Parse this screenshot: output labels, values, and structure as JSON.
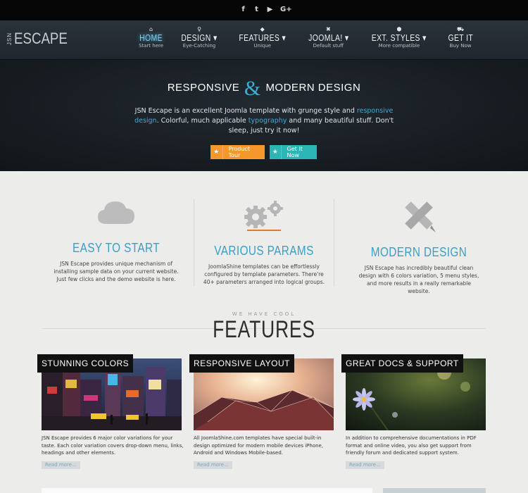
{
  "social": {
    "icons": [
      {
        "name": "facebook-icon",
        "glyph": "f"
      },
      {
        "name": "twitter-icon",
        "glyph": "t"
      },
      {
        "name": "youtube-icon",
        "glyph": "▶"
      },
      {
        "name": "google-plus-icon",
        "glyph": "G+"
      }
    ]
  },
  "logo": {
    "prefix": "JSN",
    "main": "ESCAPE"
  },
  "nav": {
    "items": [
      {
        "icon": "⌂",
        "label": "HOME",
        "sub": "Start here"
      },
      {
        "icon": "♀",
        "label": "DESIGN ▾",
        "sub": "Eye-Catching"
      },
      {
        "icon": "◆",
        "label": "FEATURES ▾",
        "sub": "Unique"
      },
      {
        "icon": "✖",
        "label": "JOOMLA! ▾",
        "sub": "Default stuff"
      },
      {
        "icon": "⬢",
        "label": "EXT. STYLES ▾",
        "sub": "More compatible"
      },
      {
        "icon": "⛟",
        "label": "GET IT",
        "sub": "Buy Now"
      }
    ]
  },
  "hero": {
    "title_left": "RESPONSIVE",
    "title_amp": "&",
    "title_right": "MODERN DESIGN",
    "text_1": "JSN Escape is an excellent Joomla template with grunge style and",
    "text_link_1": "responsive design",
    "text_2": ". Colorful, much applicable",
    "text_link_2": "typography",
    "text_3": "and many beautiful stuff. Don't sleep, just try it now!",
    "btn_tour": "Product Tour",
    "btn_get": "Get It Now"
  },
  "columns": [
    {
      "title": "EASY TO START",
      "icon": "cloud-icon",
      "text": "JSN Escape provides unique mechanism of installing sample data on your current website. Just few clicks and the demo website is here."
    },
    {
      "title": "VARIOUS PARAMS",
      "icon": "gears-icon",
      "text": "JoomlaShine templates can be effortlessly configured by template parameters. There're 40+ parameters arranged into logical groups."
    },
    {
      "title": "MODERN DESIGN",
      "icon": "pencil-ruler-icon",
      "text": "JSN Escape has incredibly beautiful clean design with 6 colors variation, 5 menu styles, and more results in a really remarkable website."
    }
  ],
  "features": {
    "subtitle": "WE HAVE COOL",
    "title": "FEATURES"
  },
  "cards": [
    {
      "tag": "STUNNING COLORS",
      "text": "JSN Escape provides 6 major color variations for your taste. Each color variation covers drop-down menu, links, headings and other elements.",
      "more": "Read more..."
    },
    {
      "tag": "RESPONSIVE LAYOUT",
      "text": "All JoomlaShine.com templates have special built-in design optimized for modern mobile devices iPhone, Android and Windows Mobile-based.",
      "more": "Read more..."
    },
    {
      "tag": "GREAT DOCS & SUPPORT",
      "text": "In addition to comprehensive documentations in PDF format and online video, you also get support from friendly forum and dedicated support system.",
      "more": "Read more..."
    }
  ],
  "colors": {
    "accent": "#3dafd6",
    "orange": "#f5982b",
    "teal": "#2bb5b5",
    "header": "#1f262d"
  }
}
